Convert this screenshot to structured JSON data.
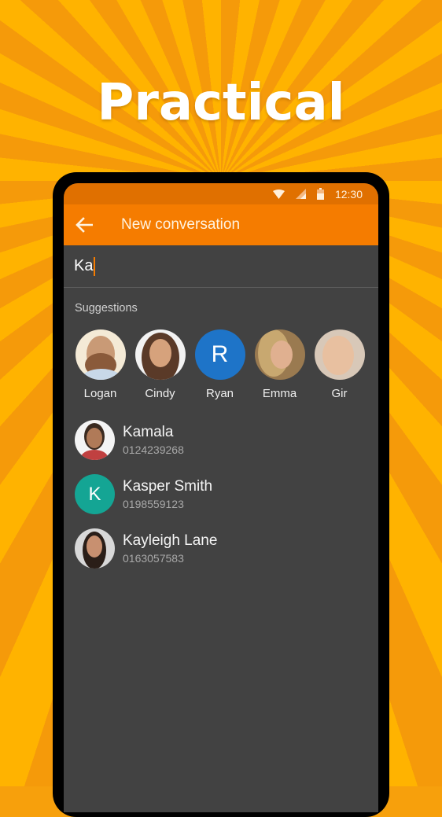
{
  "promo": {
    "headline": "Practical",
    "background_color": "#f7a00c"
  },
  "status_bar": {
    "time": "12:30",
    "icons": [
      "wifi-icon",
      "signal-icon",
      "battery-icon"
    ],
    "color": "#e07000"
  },
  "app_bar": {
    "back_icon": "arrow-left-icon",
    "title": "New conversation",
    "color": "#f57c00"
  },
  "search": {
    "value": "Ka",
    "caret_color": "#f57c00"
  },
  "suggestions": {
    "label": "Suggestions",
    "items": [
      {
        "name": "Logan",
        "avatar": "photo"
      },
      {
        "name": "Cindy",
        "avatar": "photo"
      },
      {
        "name": "Ryan",
        "avatar": "letter",
        "letter": "R",
        "color": "#1e74c8"
      },
      {
        "name": "Emma",
        "avatar": "photo"
      },
      {
        "name": "Gir",
        "avatar": "photo"
      }
    ]
  },
  "contacts": [
    {
      "name": "Kamala",
      "number": "0124239268",
      "avatar": "photo"
    },
    {
      "name": "Kasper Smith",
      "number": "0198559123",
      "avatar": "letter",
      "letter": "K",
      "color": "#14a594"
    },
    {
      "name": "Kayleigh Lane",
      "number": "0163057583",
      "avatar": "photo"
    }
  ]
}
